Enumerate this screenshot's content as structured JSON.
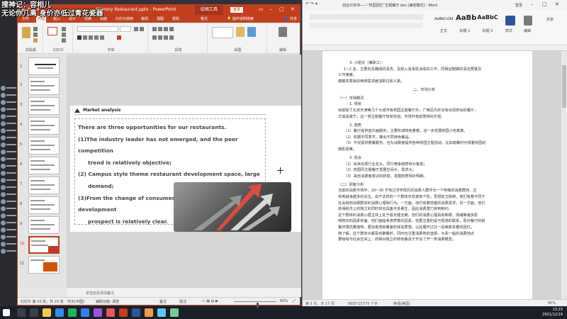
{
  "overlay": {
    "line1": "搜神记：容相儿",
    "line2": "无论你几离 身价亦低过青花瓷器"
  },
  "ppt": {
    "title": "Memory Restaurant.pptx - PowerPoint",
    "context_tab": "绘图工具",
    "login": "登录",
    "tabs": [
      "文件",
      "开始",
      "插入",
      "设计",
      "切换",
      "动画",
      "幻灯片放映",
      "审阅",
      "视图",
      "帮助",
      "格式"
    ],
    "tell_me": "操作说明搜索",
    "share": "共享",
    "ribbon_groups": [
      "剪贴板",
      "幻灯片",
      "字体",
      "段落",
      "绘图",
      "编辑"
    ],
    "slide_numbers": [
      "1",
      "2",
      "3",
      "4",
      "5",
      "6",
      "7",
      "8",
      "9",
      "10",
      "11"
    ],
    "slide": {
      "header": "Market analysis",
      "lines": [
        "There are three opportunities for our restaurants.",
        "(1)The industry leader has not emerged, and the peer competition",
        "trend is relatively objective;",
        "(2) Campus style theme restaurant development space, large",
        "demand;",
        "(3)From the change of consumer consciousness, the development",
        "prospect is relatively clear."
      ]
    },
    "notes_placeholder": "单击此处添加备注",
    "status": {
      "slide_pos": "幻灯片 第 10 张，共 23 张",
      "lang": "中文(中国)",
      "accessibility": "辅助功能: 调查",
      "notes": "备注",
      "comments": "批注",
      "zoom": "60%",
      "zoom_fraction": 0.55
    }
  },
  "word": {
    "title": "创业计划书——“校园回忆”主题餐厅.doc [兼容模式] - Word",
    "login": "登录",
    "styles": [
      {
        "big": "AaBbCcDd",
        "label": "正文"
      },
      {
        "big": "AaBb",
        "label": "标题 1"
      },
      {
        "big": "AaBbC",
        "label": "标题 2"
      }
    ],
    "style_pane_label": "样式",
    "edit_label": "编辑",
    "share": "共享",
    "lines": [
      "3.  小组长（兼职工）：",
      "1~2 名，主要负责确保的清洗、及放入消毒机消毒的工作，同保证碗碟的清洁质量及",
      "工作速度。",
      "     期期发票良好两按需求雇加职位和人数。",
      "二、市场分析",
      "（一）市场概况",
      "1.  规状",
      "目前除了北京天津等几个大城市有校园主题餐厅外，广西区内并没有出现类似的餐厅，",
      "尤其是南宁，这一类主题餐厅较受欢迎。市场开拓前景相对乐观。",
      "2.  趋势",
      "（1）餐厅提供音乐面服务，主要形成特色着着，进一步发展校园小吃着着。",
      "（2）依据不同季节，推出不同特色餐品。",
      "（3）不仅提供着餐服务，也为消费者提供各种校园主题活动，比如南餐时可观看校园的",
      "典影视等。",
      "3.  机会",
      "（1）尚未出现行业龙头，同行竞争趋势较为客观；",
      "（2）校园风主题餐厅发展空间大，需求大；",
      "（3）来自消费者意识的转变，发展前景相对明朗。",
      "（二）顾客分析",
      "当前的消费市场中，20~30 岁有过求学经历的消费人群作为一个特殊的消费群体，正",
      "受到越来越多的关注。由于这样的一个群体年轻富有个性，思想前卫独特，他们有着不同于",
      "社会其他消费群体的消费心理和行为。一方面，他们有着旺盛的消费需求，另一方面，他们",
      "获得经济上的独立的同时却也具备许多量生，因此消费潜力受到制约。",
      "这个群体的消费心理主体上处于成长健全期，他们的消费心理具有新颖、情绪等诸多影",
      "响购买的因素受面。他们面临考虑质量的因素，但更注重的是与情感的联系，而对餐厅的就",
      "餐环境优雅独特，更加考虑就餐者的体验质感，以此展开过往一段美丽青春的回忆。",
      "随了解，这个群体大都喜欢聚餐时，同时也注重消费地的选择，为而一般的消费地点",
      "要吸吸与社会空间上，而相对独立的特色餐具于开设了开一类消费概念。"
    ],
    "line_styles": [
      "n",
      "n",
      "n",
      "n",
      "h",
      "n",
      "n",
      "n",
      "n",
      "n",
      "n",
      "n",
      "n",
      "n",
      "n",
      "n",
      "n",
      "n",
      "n",
      "n",
      "n",
      "n",
      "n",
      "n",
      "n",
      "n",
      "n",
      "n"
    ],
    "status_left": "第 5 页，共 17 页",
    "status_words": "8697/15779 个字",
    "status_lang": "英语(美国)",
    "zoom": "80%"
  },
  "taskbar": {
    "time": "13:23",
    "date": "2021/12/19"
  },
  "colors": {
    "ppt_accent": "#c43e1c",
    "word_accent": "#2b579a"
  }
}
